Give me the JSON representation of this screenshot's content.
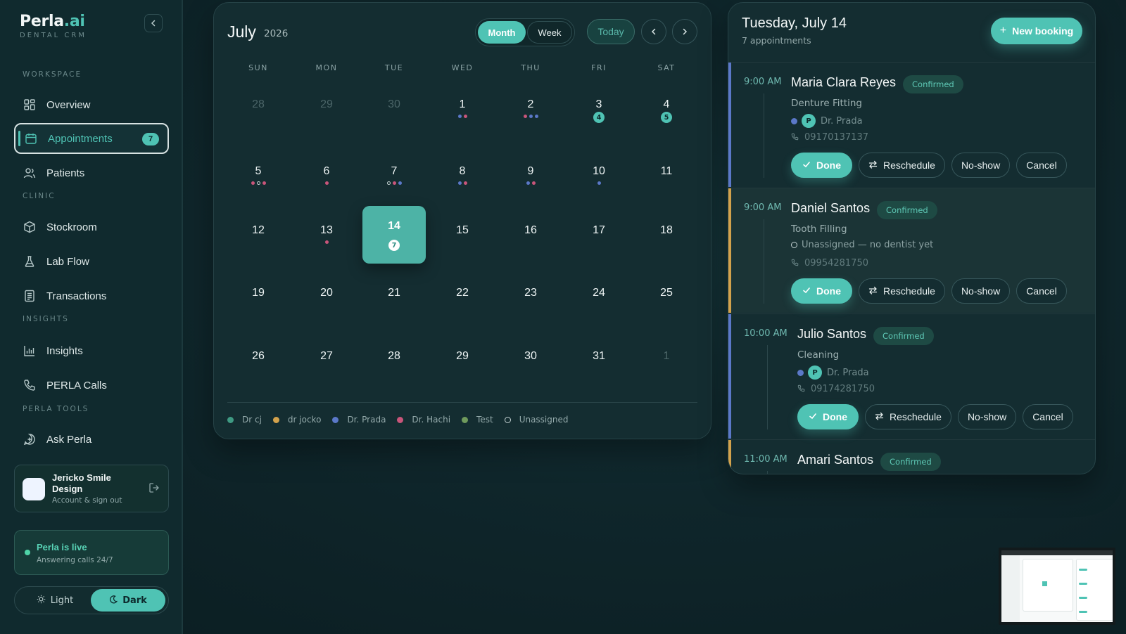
{
  "brand": {
    "name": "Perla",
    "suffix": ".ai",
    "subtitle": "DENTAL CRM"
  },
  "sidebar": {
    "sections": {
      "workspace": "WORKSPACE",
      "clinic": "CLINIC",
      "insights": "INSIGHTS",
      "tools": "PERLA TOOLS"
    },
    "items": [
      {
        "label": "Overview",
        "icon": "grid-icon"
      },
      {
        "label": "Appointments",
        "icon": "calendar-icon",
        "badge": "7",
        "active": true
      },
      {
        "label": "Patients",
        "icon": "users-icon"
      },
      {
        "label": "Stockroom",
        "icon": "box-icon"
      },
      {
        "label": "Lab Flow",
        "icon": "flask-icon"
      },
      {
        "label": "Transactions",
        "icon": "receipt-icon"
      },
      {
        "label": "Insights",
        "icon": "bar-chart-icon"
      },
      {
        "label": "PERLA Calls",
        "icon": "phone-icon"
      },
      {
        "label": "Ask Perla",
        "icon": "chat-icon"
      }
    ],
    "account": {
      "name": "Jericko Smile Design",
      "subtitle": "Account & sign out"
    },
    "live": {
      "title": "Perla is live",
      "subtitle": "Answering calls 24/7"
    },
    "theme": {
      "light": "Light",
      "dark": "Dark",
      "selected": "Dark"
    }
  },
  "calendar": {
    "month": "July",
    "year": "2026",
    "views": {
      "month": "Month",
      "week": "Week",
      "selected": "Month"
    },
    "today_label": "Today",
    "weekdays": [
      "SUN",
      "MON",
      "TUE",
      "WED",
      "THU",
      "FRI",
      "SAT"
    ],
    "weeks": [
      [
        {
          "day": "28",
          "muted": true
        },
        {
          "day": "29",
          "muted": true
        },
        {
          "day": "30",
          "muted": true
        },
        {
          "day": "1",
          "dots": [
            "#5b78c8",
            "#c9557a"
          ]
        },
        {
          "day": "2",
          "dots": [
            "#c9557a",
            "#5b78c8",
            "#5b78c8"
          ]
        },
        {
          "day": "3",
          "count": "4"
        },
        {
          "day": "4",
          "count": "5"
        }
      ],
      [
        {
          "day": "5",
          "dots": [
            "#c9557a",
            "hollow",
            "#c9557a"
          ]
        },
        {
          "day": "6",
          "dots": [
            "#c9557a"
          ]
        },
        {
          "day": "7",
          "dots": [
            "hollow",
            "#c9557a",
            "#5b78c8"
          ]
        },
        {
          "day": "8",
          "dots": [
            "#5b78c8",
            "#c9557a"
          ]
        },
        {
          "day": "9",
          "dots": [
            "#5b78c8",
            "#c9557a"
          ]
        },
        {
          "day": "10",
          "dots": [
            "#5b78c8"
          ]
        },
        {
          "day": "11"
        }
      ],
      [
        {
          "day": "12"
        },
        {
          "day": "13",
          "dots": [
            "#c9557a"
          ]
        },
        {
          "day": "14",
          "count": "7",
          "selected": true
        },
        {
          "day": "15"
        },
        {
          "day": "16"
        },
        {
          "day": "17"
        },
        {
          "day": "18"
        }
      ],
      [
        {
          "day": "19"
        },
        {
          "day": "20"
        },
        {
          "day": "21"
        },
        {
          "day": "22"
        },
        {
          "day": "23"
        },
        {
          "day": "24"
        },
        {
          "day": "25"
        }
      ],
      [
        {
          "day": "26"
        },
        {
          "day": "27"
        },
        {
          "day": "28"
        },
        {
          "day": "29"
        },
        {
          "day": "30"
        },
        {
          "day": "31"
        },
        {
          "day": "1",
          "muted": true
        }
      ]
    ],
    "legend": [
      {
        "label": "Dr cj",
        "color": "#3f9a83"
      },
      {
        "label": "dr jocko",
        "color": "#d3a24c"
      },
      {
        "label": "Dr. Prada",
        "color": "#5b78c8"
      },
      {
        "label": "Dr. Hachi",
        "color": "#c9557a"
      },
      {
        "label": "Test",
        "color": "#6f9a5c"
      },
      {
        "label": "Unassigned",
        "color": "hollow"
      }
    ]
  },
  "day_panel": {
    "title": "Tuesday, July 14",
    "count": "7 appointments",
    "new_booking": "New booking",
    "actions": {
      "done": "Done",
      "reschedule": "Reschedule",
      "noshow": "No-show",
      "cancel": "Cancel"
    },
    "appointments": [
      {
        "time": "9:00 AM",
        "name": "Maria Clara Reyes",
        "status": "Confirmed",
        "service": "Denture Fitting",
        "dentist": "Dr. Prada",
        "dentist_initial": "P",
        "dentist_color": "#5b78c8",
        "phone": "09170137137",
        "bar_color": "#5b78c8"
      },
      {
        "time": "9:00 AM",
        "name": "Daniel Santos",
        "status": "Confirmed",
        "service": "Tooth Filling",
        "dentist": "Unassigned — no dentist yet",
        "unassigned": true,
        "phone": "09954281750",
        "bar_color": "#d3a24c"
      },
      {
        "time": "10:00 AM",
        "name": "Julio Santos",
        "status": "Confirmed",
        "service": "Cleaning",
        "dentist": "Dr. Prada",
        "dentist_initial": "P",
        "dentist_color": "#5b78c8",
        "phone": "09174281750",
        "bar_color": "#5b78c8"
      },
      {
        "time": "11:00 AM",
        "name": "Amari Santos",
        "status": "Confirmed",
        "bar_color": "#d3a24c"
      }
    ]
  }
}
